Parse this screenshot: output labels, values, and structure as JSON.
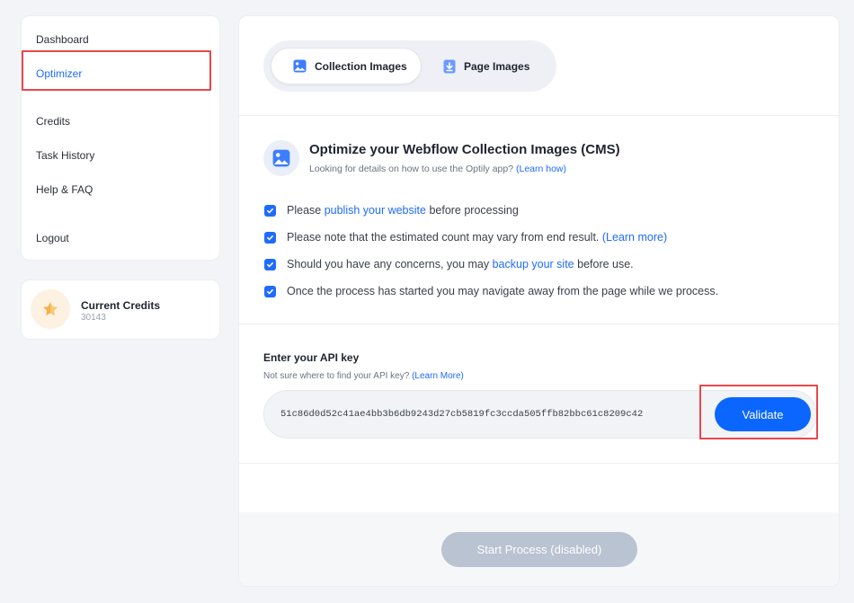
{
  "sidebar": {
    "items": [
      {
        "label": "Dashboard"
      },
      {
        "label": "Optimizer"
      },
      {
        "label": "Credits"
      },
      {
        "label": "Task History"
      },
      {
        "label": "Help & FAQ"
      },
      {
        "label": "Logout"
      }
    ],
    "active_index": 1
  },
  "credits": {
    "title": "Current Credits",
    "value": "30143",
    "icon": "star-icon"
  },
  "tabs": [
    {
      "label": "Collection Images",
      "icon": "image-icon",
      "active": true
    },
    {
      "label": "Page Images",
      "icon": "download-file-icon",
      "active": false
    }
  ],
  "info": {
    "icon": "image-icon",
    "title": "Optimize your Webflow Collection Images (CMS)",
    "subtitle_prefix": "Looking for details on how to use the Optily app? ",
    "subtitle_link": "(Learn how)"
  },
  "checklist": [
    {
      "pre": "Please ",
      "link": "publish your website",
      "post": " before processing"
    },
    {
      "pre": "Please note that the estimated count may vary from end result. ",
      "link": "(Learn more)",
      "post": ""
    },
    {
      "pre": "Should you have any concerns, you may ",
      "link": "backup your site",
      "post": " before use."
    },
    {
      "pre": "Once the process has started you may navigate away from the page while we process.",
      "link": "",
      "post": ""
    }
  ],
  "api": {
    "label": "Enter your API key",
    "hint_prefix": "Not sure where to find your API key? ",
    "hint_link": "(Learn More)",
    "value": "51c86d0d52c41ae4bb3b6db9243d27cb5819fc3ccda505ffb82bbc61c8209c42",
    "validate_label": "Validate"
  },
  "start_button": {
    "label": "Start Process (disabled)"
  },
  "colors": {
    "accent": "#0a66ff",
    "link": "#1f6bff",
    "highlight": "#e8474b",
    "disabled": "#b9c3d1"
  }
}
